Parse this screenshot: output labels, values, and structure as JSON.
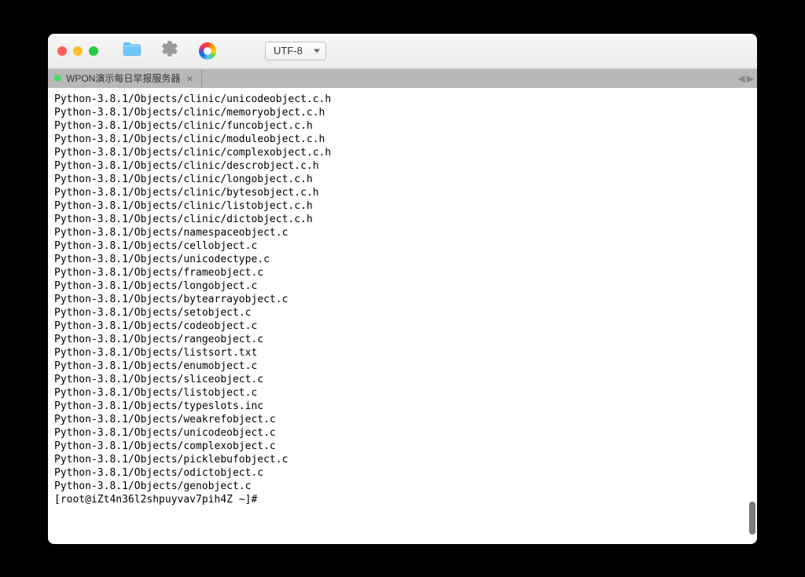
{
  "toolbar": {
    "encoding": "UTF-8"
  },
  "tab": {
    "title": "WPON演示每日早报服务器",
    "close": "×"
  },
  "terminal": {
    "lines": [
      "Python-3.8.1/Objects/clinic/unicodeobject.c.h",
      "Python-3.8.1/Objects/clinic/memoryobject.c.h",
      "Python-3.8.1/Objects/clinic/funcobject.c.h",
      "Python-3.8.1/Objects/clinic/moduleobject.c.h",
      "Python-3.8.1/Objects/clinic/complexobject.c.h",
      "Python-3.8.1/Objects/clinic/descrobject.c.h",
      "Python-3.8.1/Objects/clinic/longobject.c.h",
      "Python-3.8.1/Objects/clinic/bytesobject.c.h",
      "Python-3.8.1/Objects/clinic/listobject.c.h",
      "Python-3.8.1/Objects/clinic/dictobject.c.h",
      "Python-3.8.1/Objects/namespaceobject.c",
      "Python-3.8.1/Objects/cellobject.c",
      "Python-3.8.1/Objects/unicodectype.c",
      "Python-3.8.1/Objects/frameobject.c",
      "Python-3.8.1/Objects/longobject.c",
      "Python-3.8.1/Objects/bytearrayobject.c",
      "Python-3.8.1/Objects/setobject.c",
      "Python-3.8.1/Objects/codeobject.c",
      "Python-3.8.1/Objects/rangeobject.c",
      "Python-3.8.1/Objects/listsort.txt",
      "Python-3.8.1/Objects/enumobject.c",
      "Python-3.8.1/Objects/sliceobject.c",
      "Python-3.8.1/Objects/listobject.c",
      "Python-3.8.1/Objects/typeslots.inc",
      "Python-3.8.1/Objects/weakrefobject.c",
      "Python-3.8.1/Objects/unicodeobject.c",
      "Python-3.8.1/Objects/complexobject.c",
      "Python-3.8.1/Objects/picklebufobject.c",
      "Python-3.8.1/Objects/odictobject.c",
      "Python-3.8.1/Objects/genobject.c"
    ],
    "prompt": "[root@iZt4n36l2shpuyvav7pih4Z ~]# "
  },
  "nav": {
    "left": "◀",
    "right": "▶"
  }
}
